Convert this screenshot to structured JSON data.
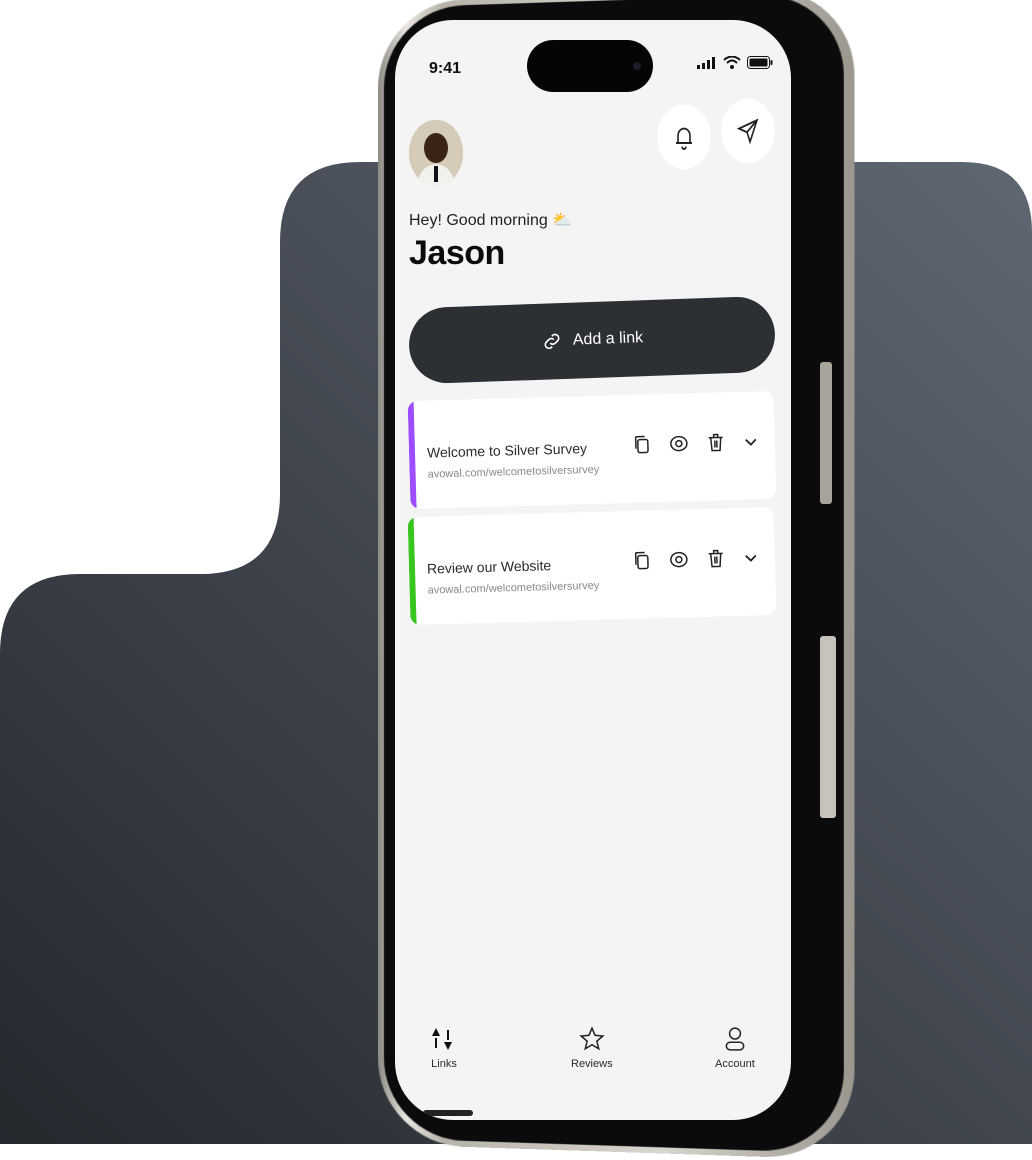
{
  "colors": {
    "accent_dark": "#2c2f34",
    "card1_bar": "#9b4dff",
    "card2_bar": "#37c51f",
    "screen_bg": "#f4f4f4"
  },
  "status_bar": {
    "time": "9:41",
    "icons": [
      "signal-icon",
      "wifi-icon",
      "battery-icon"
    ]
  },
  "header": {
    "greeting": "Hey! Good morning",
    "greeting_icon": "sun-cloud-icon",
    "user_name": "Jason",
    "buttons": [
      "bell-icon",
      "send-icon"
    ]
  },
  "add_link": {
    "label": "Add a link",
    "icon": "link-icon"
  },
  "links": [
    {
      "title": "Welcome to Silver Survey",
      "url": "avowal.com/welcometosilversurvey",
      "accent": "#9b4dff"
    },
    {
      "title": "Review our Website",
      "url": "avowal.com/welcometosilversurvey",
      "accent": "#37c51f"
    }
  ],
  "card_actions": [
    "copy-icon",
    "eye-icon",
    "trash-icon",
    "chevron-down-icon"
  ],
  "bottom_nav": [
    {
      "label": "Links",
      "icon": "links-icon",
      "active": true
    },
    {
      "label": "Reviews",
      "icon": "star-icon",
      "active": false
    },
    {
      "label": "Account",
      "icon": "user-icon",
      "active": false
    }
  ]
}
